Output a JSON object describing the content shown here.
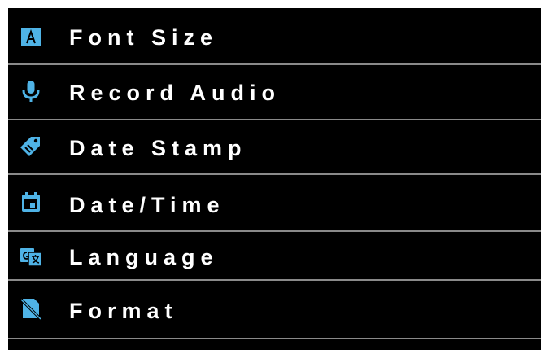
{
  "colors": {
    "background": "#000000",
    "text": "#ffffff",
    "icon": "#4fb3e6",
    "divider": "#8a8a8a"
  },
  "menu": {
    "items": [
      {
        "label": "Font Size",
        "icon": "font-size-icon"
      },
      {
        "label": "Record Audio",
        "icon": "microphone-icon"
      },
      {
        "label": "Date Stamp",
        "icon": "tag-icon"
      },
      {
        "label": "Date/Time",
        "icon": "calendar-icon"
      },
      {
        "label": "Language",
        "icon": "translate-icon"
      },
      {
        "label": "Format",
        "icon": "format-icon"
      }
    ]
  }
}
